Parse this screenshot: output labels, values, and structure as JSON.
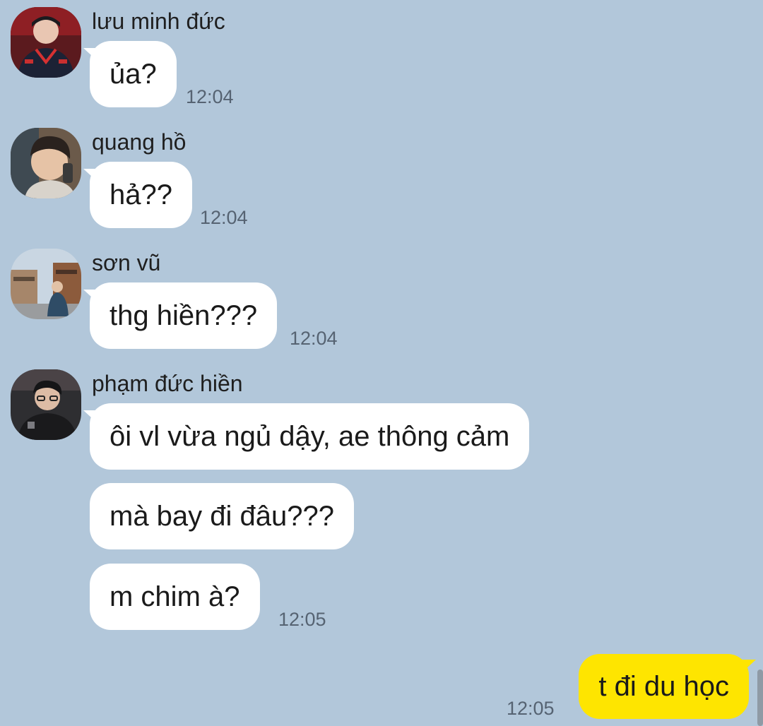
{
  "messages": [
    {
      "sender": "lưu minh đức",
      "lines": [
        {
          "text": "ủa?",
          "time": "12:04"
        }
      ]
    },
    {
      "sender": "quang hồ",
      "lines": [
        {
          "text": "hả??",
          "time": "12:04"
        }
      ]
    },
    {
      "sender": "sơn vũ",
      "lines": [
        {
          "text": "thg hiền???",
          "time": "12:04"
        }
      ]
    },
    {
      "sender": "phạm đức hiền",
      "lines": [
        {
          "text": "ôi vl vừa ngủ dậy, ae thông cảm",
          "time": ""
        },
        {
          "text": "mà bay đi đâu???",
          "time": ""
        },
        {
          "text": "m chim à?",
          "time": "12:05"
        }
      ]
    }
  ],
  "outgoing": {
    "text": "t đi du học",
    "time": "12:05"
  },
  "colors": {
    "background": "#b2c7da",
    "incoming_bubble": "#ffffff",
    "outgoing_bubble": "#fee500"
  },
  "icons": {
    "avatar_1": "profile-photo-avatar",
    "avatar_2": "profile-photo-avatar",
    "avatar_3": "profile-photo-avatar",
    "avatar_4": "profile-photo-avatar"
  }
}
